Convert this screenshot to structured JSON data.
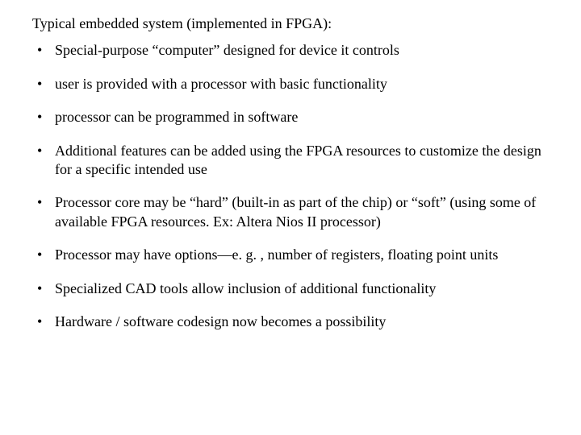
{
  "title": "Typical embedded system (implemented in FPGA):",
  "bullets": [
    "Special-purpose “computer” designed for device it controls",
    "user is provided with a processor with basic functionality",
    "processor can be programmed in software",
    "Additional features can be added using the FPGA resources to customize the design for a specific intended use",
    "Processor core may be “hard” (built-in as part of the chip) or “soft” (using some of available FPGA resources.  Ex: Altera Nios II processor)",
    "Processor may have options—e. g. , number of registers, floating point units",
    "Specialized CAD tools allow inclusion of additional functionality",
    "Hardware / software codesign now becomes a possibility"
  ]
}
